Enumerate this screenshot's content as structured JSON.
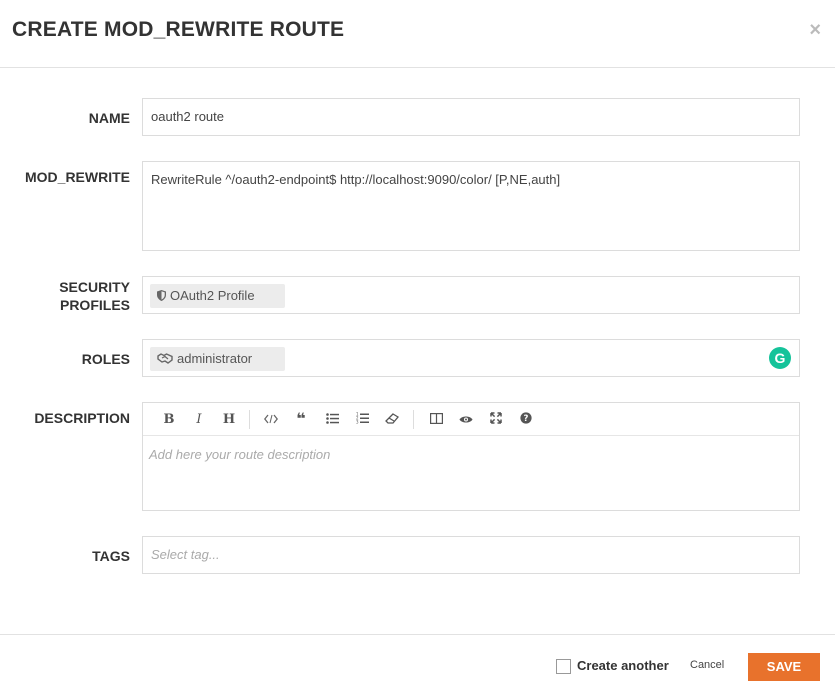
{
  "modal": {
    "title": "CREATE MOD_REWRITE ROUTE",
    "close_glyph": "×"
  },
  "form": {
    "name": {
      "label": "NAME",
      "value": "oauth2 route"
    },
    "mod_rewrite": {
      "label": "MOD_REWRITE",
      "value": "RewriteRule ^/oauth2-endpoint$ http://localhost:9090/color/ [P,NE,auth]"
    },
    "security_profiles": {
      "label_line1": "SECURITY",
      "label_line2": "PROFILES",
      "chip": "OAuth2 Profile",
      "chip_icon": "shield-icon"
    },
    "roles": {
      "label": "ROLES",
      "chip": "administrator",
      "chip_icon": "handshake-icon",
      "grammarly": "G"
    },
    "description": {
      "label": "DESCRIPTION",
      "placeholder": "Add here your route description",
      "toolbar": [
        "bold-icon",
        "italic-icon",
        "heading-icon",
        "code-icon",
        "quote-icon",
        "unordered-list-icon",
        "ordered-list-icon",
        "eraser-icon",
        "side-by-side-icon",
        "preview-icon",
        "fullscreen-icon",
        "help-icon"
      ]
    },
    "tags": {
      "label": "TAGS",
      "placeholder": "Select tag..."
    }
  },
  "footer": {
    "create_another": "Create another",
    "cancel": "Cancel",
    "save": "SAVE"
  },
  "colors": {
    "save_button": "#e8722c",
    "grammarly": "#15c39a"
  }
}
